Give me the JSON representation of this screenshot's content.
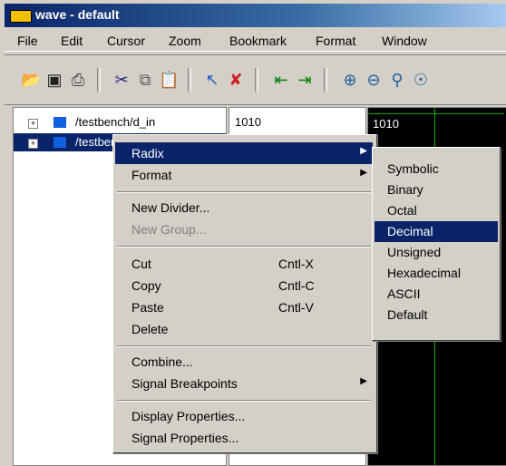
{
  "window": {
    "title": "wave - default"
  },
  "menubar": [
    "File",
    "Edit",
    "Cursor",
    "Zoom",
    "Bookmark",
    "Format",
    "Window"
  ],
  "toolbar": {
    "icons": [
      "open-folder-icon",
      "save-icon",
      "print-icon",
      "cut-icon",
      "copy-icon",
      "paste-icon",
      "select-pointer-icon",
      "delete-icon",
      "goto-prev-edge-icon",
      "goto-next-edge-icon",
      "zoom-in-icon",
      "zoom-out-icon",
      "zoom-full-icon",
      "zoom-cursor-icon"
    ]
  },
  "signals": [
    {
      "name": "/testbench/d_in",
      "value": "1010",
      "wave": "1010"
    },
    {
      "name": "/testbench/...",
      "value": "",
      "wave": ""
    }
  ],
  "context_menu": {
    "items": [
      {
        "label": "Radix",
        "shortcut": "",
        "submenu": true,
        "selected": true,
        "disabled": false
      },
      {
        "label": "Format",
        "shortcut": "",
        "submenu": true,
        "selected": false,
        "disabled": false
      },
      {
        "label": "New Divider...",
        "shortcut": "",
        "submenu": false,
        "selected": false,
        "disabled": false
      },
      {
        "label": "New Group...",
        "shortcut": "",
        "submenu": false,
        "selected": false,
        "disabled": true
      },
      {
        "label": "Cut",
        "shortcut": "Cntl-X",
        "submenu": false,
        "selected": false,
        "disabled": false
      },
      {
        "label": "Copy",
        "shortcut": "Cntl-C",
        "submenu": false,
        "selected": false,
        "disabled": false
      },
      {
        "label": "Paste",
        "shortcut": "Cntl-V",
        "submenu": false,
        "selected": false,
        "disabled": false
      },
      {
        "label": "Delete",
        "shortcut": "",
        "submenu": false,
        "selected": false,
        "disabled": false
      },
      {
        "label": "Combine...",
        "shortcut": "",
        "submenu": false,
        "selected": false,
        "disabled": false
      },
      {
        "label": "Signal Breakpoints",
        "shortcut": "",
        "submenu": true,
        "selected": false,
        "disabled": false
      },
      {
        "label": "Display Properties...",
        "shortcut": "",
        "submenu": false,
        "selected": false,
        "disabled": false
      },
      {
        "label": "Signal Properties...",
        "shortcut": "",
        "submenu": false,
        "selected": false,
        "disabled": false
      }
    ]
  },
  "radix_submenu": {
    "items": [
      "Symbolic",
      "Binary",
      "Octal",
      "Decimal",
      "Unsigned",
      "Hexadecimal",
      "ASCII",
      "Default"
    ],
    "selected": "Decimal"
  },
  "colors": {
    "title_start": "#0a246a",
    "title_end": "#a6caf0",
    "selection": "#0a246a",
    "signal_square": "#1060e0",
    "wave_green": "#00b000"
  }
}
